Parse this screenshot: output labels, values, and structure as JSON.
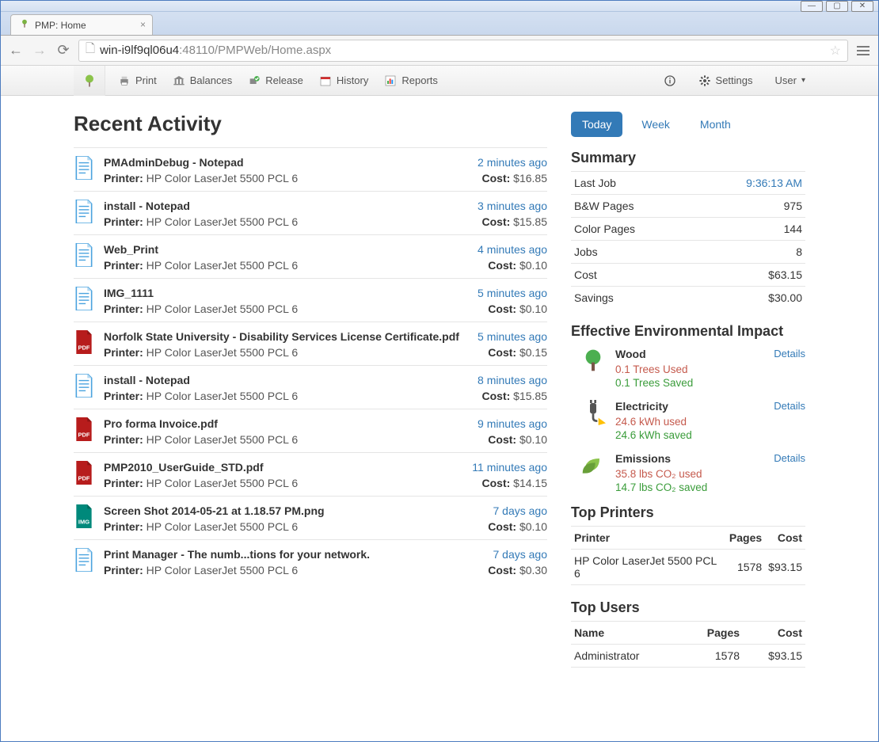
{
  "window": {
    "tab_title": "PMP: Home",
    "url_host": "win-i9lf9ql06u4",
    "url_port_path": ":48110/PMPWeb/Home.aspx"
  },
  "navbar": {
    "print": "Print",
    "balances": "Balances",
    "release": "Release",
    "history": "History",
    "reports": "Reports",
    "settings": "Settings",
    "user": "User"
  },
  "page": {
    "title": "Recent Activity"
  },
  "activity": [
    {
      "icon": "doc",
      "title": "PMAdminDebug - Notepad",
      "time": "2 minutes ago",
      "printer": "HP Color LaserJet 5500 PCL 6",
      "cost": "$16.85"
    },
    {
      "icon": "doc",
      "title": "install - Notepad",
      "time": "3 minutes ago",
      "printer": "HP Color LaserJet 5500 PCL 6",
      "cost": "$15.85"
    },
    {
      "icon": "doc",
      "title": "Web_Print",
      "time": "4 minutes ago",
      "printer": "HP Color LaserJet 5500 PCL 6",
      "cost": "$0.10"
    },
    {
      "icon": "doc",
      "title": "IMG_1111",
      "time": "5 minutes ago",
      "printer": "HP Color LaserJet 5500 PCL 6",
      "cost": "$0.10"
    },
    {
      "icon": "pdf",
      "title": "Norfolk State University - Disability Services License Certificate.pdf",
      "time": "5 minutes ago",
      "printer": "HP Color LaserJet 5500 PCL 6",
      "cost": "$0.15"
    },
    {
      "icon": "doc",
      "title": "install - Notepad",
      "time": "8 minutes ago",
      "printer": "HP Color LaserJet 5500 PCL 6",
      "cost": "$15.85"
    },
    {
      "icon": "pdf",
      "title": "Pro forma Invoice.pdf",
      "time": "9 minutes ago",
      "printer": "HP Color LaserJet 5500 PCL 6",
      "cost": "$0.10"
    },
    {
      "icon": "pdf",
      "title": "PMP2010_UserGuide_STD.pdf",
      "time": "11 minutes ago",
      "printer": "HP Color LaserJet 5500 PCL 6",
      "cost": "$14.15"
    },
    {
      "icon": "img",
      "title": "Screen Shot 2014-05-21 at 1.18.57 PM.png",
      "time": "7 days ago",
      "printer": "HP Color LaserJet 5500 PCL 6",
      "cost": "$0.10"
    },
    {
      "icon": "doc",
      "title": "Print Manager - The numb...tions for your network.",
      "time": "7 days ago",
      "printer": "HP Color LaserJet 5500 PCL 6",
      "cost": "$0.30"
    }
  ],
  "labels": {
    "printer": "Printer:",
    "cost": "Cost:"
  },
  "sidebar": {
    "tabs": {
      "today": "Today",
      "week": "Week",
      "month": "Month"
    },
    "summary_title": "Summary",
    "summary": [
      {
        "label": "Last Job",
        "value": "9:36:13 AM",
        "link": true
      },
      {
        "label": "B&W Pages",
        "value": "975"
      },
      {
        "label": "Color Pages",
        "value": "144"
      },
      {
        "label": "Jobs",
        "value": "8"
      },
      {
        "label": "Cost",
        "value": "$63.15"
      },
      {
        "label": "Savings",
        "value": "$30.00"
      }
    ],
    "env_title": "Effective Environmental Impact",
    "details_label": "Details",
    "env": {
      "wood": {
        "title": "Wood",
        "used": "0.1 Trees Used",
        "saved": "0.1 Trees Saved"
      },
      "electricity": {
        "title": "Electricity",
        "used": "24.6 kWh used",
        "saved": "24.6 kWh saved"
      },
      "emissions": {
        "title": "Emissions",
        "used": "35.8 lbs CO₂ used",
        "saved": "14.7 lbs CO₂ saved"
      }
    },
    "top_printers": {
      "title": "Top Printers",
      "headers": {
        "printer": "Printer",
        "pages": "Pages",
        "cost": "Cost"
      },
      "rows": [
        {
          "printer": "HP Color LaserJet 5500 PCL 6",
          "pages": "1578",
          "cost": "$93.15"
        }
      ]
    },
    "top_users": {
      "title": "Top Users",
      "headers": {
        "name": "Name",
        "pages": "Pages",
        "cost": "Cost"
      },
      "rows": [
        {
          "name": "Administrator",
          "pages": "1578",
          "cost": "$93.15"
        }
      ]
    }
  }
}
